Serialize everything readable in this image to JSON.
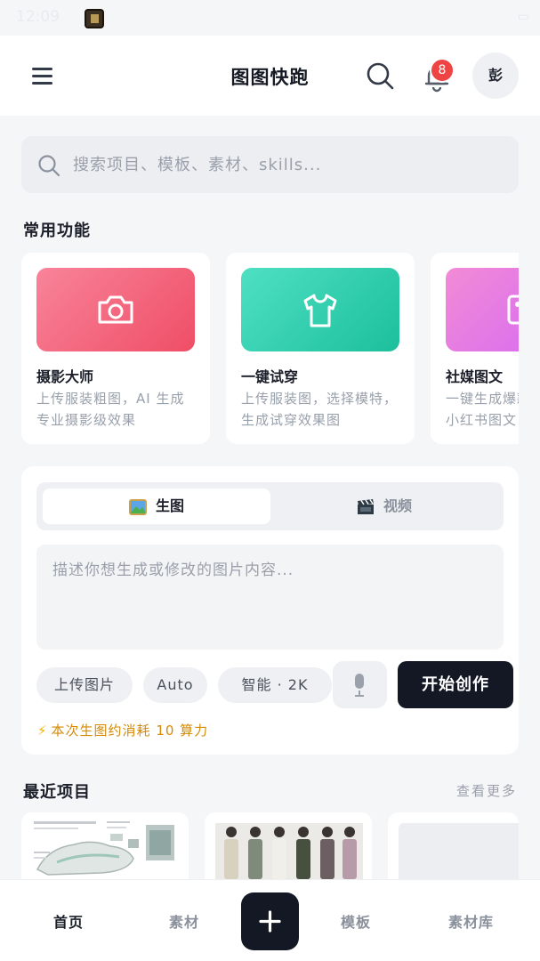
{
  "status_bar": {
    "time": "12:09",
    "battery": "▭"
  },
  "header": {
    "title": "图图快跑",
    "notification_count": "8",
    "avatar_text": "彭"
  },
  "search": {
    "placeholder": "搜索项目、模板、素材、skills..."
  },
  "features": {
    "title": "常用功能",
    "items": [
      {
        "title": "摄影大师",
        "desc": "上传服装粗图，AI 生成专业摄影级效果",
        "icon": "camera-icon",
        "color_from": "#f8849a",
        "color_to": "#ef4e66"
      },
      {
        "title": "一键试穿",
        "desc": "上传服装图，选择模特，生成试穿效果图",
        "icon": "shirt-icon",
        "color_from": "#4ee0c2",
        "color_to": "#1cbf9c"
      },
      {
        "title": "社媒图文",
        "desc": "一键生成爆款小红书图文",
        "icon": "image-icon",
        "color_from": "#f28bd6",
        "color_to": "#d86cf0"
      }
    ]
  },
  "creator": {
    "tabs": [
      {
        "label": "生图",
        "icon": "picture-icon",
        "active": true
      },
      {
        "label": "视频",
        "icon": "clapper-icon",
        "active": false
      }
    ],
    "prompt_placeholder": "描述你想生成或修改的图片内容...",
    "chips": {
      "upload": "上传图片",
      "ratio": "Auto",
      "quality": "智能 · 2K"
    },
    "start_label": "开始创作",
    "cost_text": "本次生图约消耗 10 算力"
  },
  "recent": {
    "title": "最近项目",
    "more": "查看更多"
  },
  "bottom_nav": {
    "home": "首页",
    "materials": "素材",
    "templates": "模板",
    "library": "素材库"
  },
  "colors": {
    "primary": "#131824",
    "badge": "#ef4444",
    "cost": "#d48a06"
  }
}
